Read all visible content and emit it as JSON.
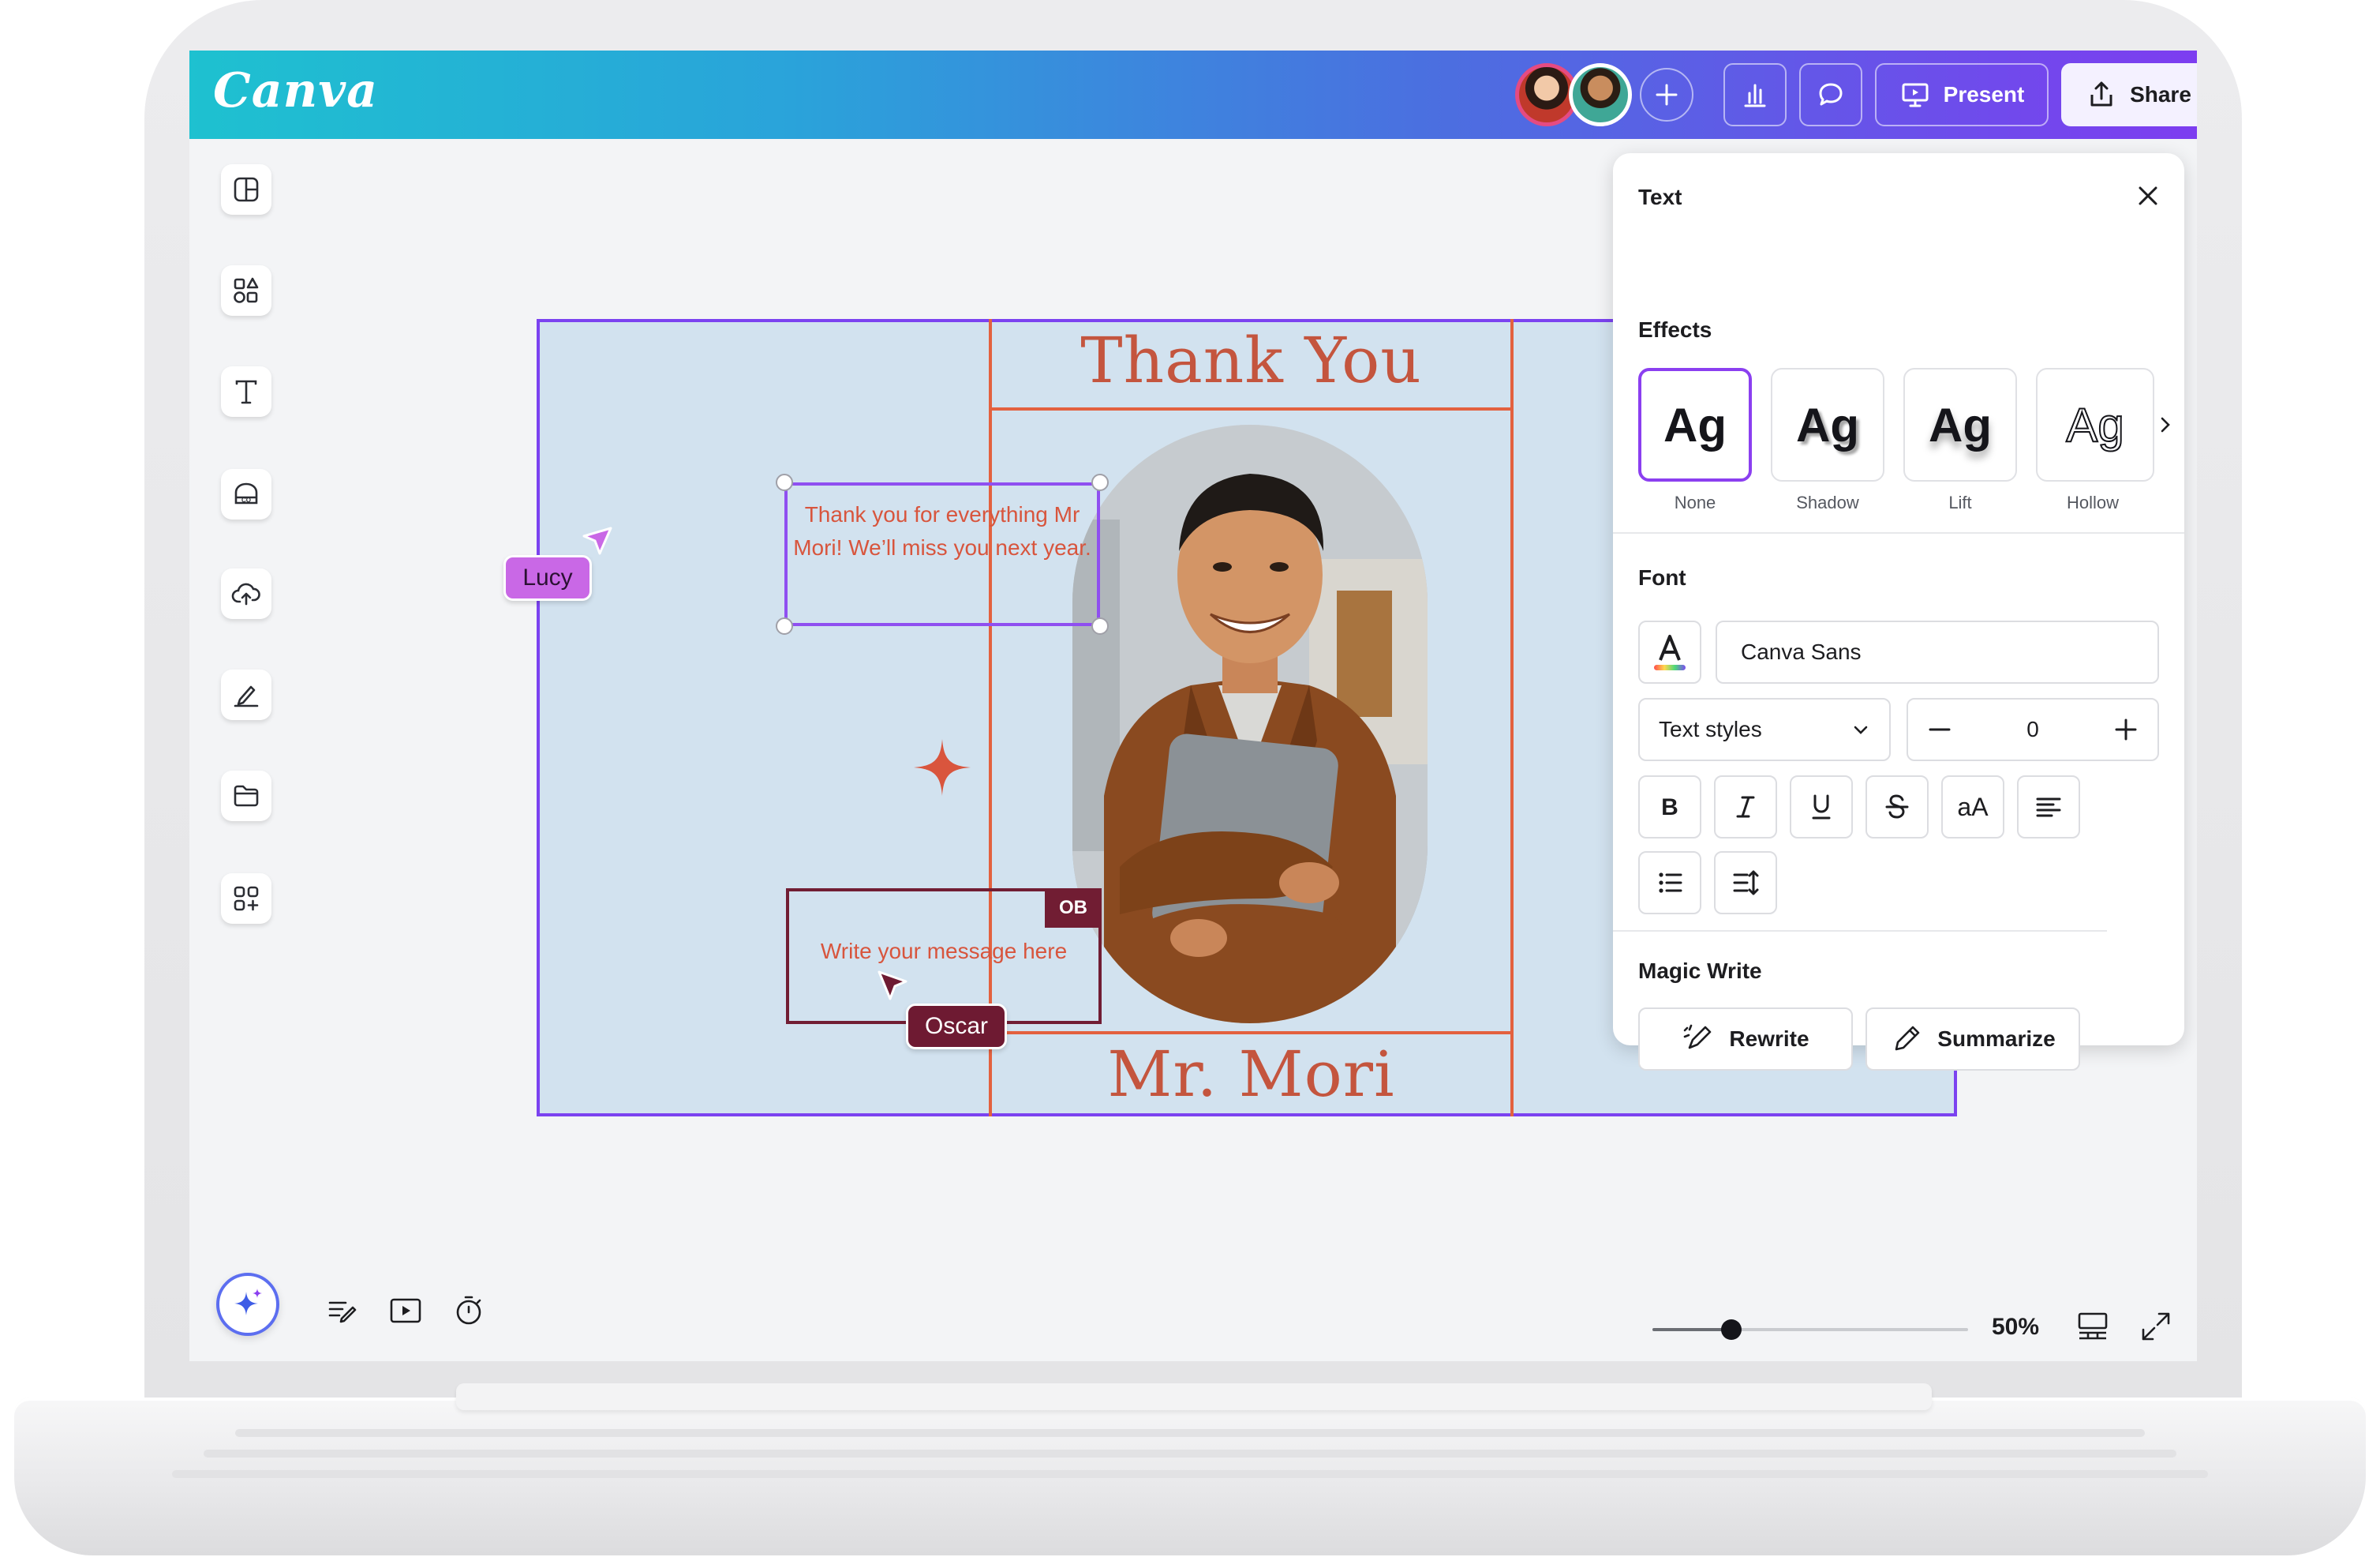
{
  "app": {
    "logo_text": "Canva"
  },
  "header": {
    "present_label": "Present",
    "share_label": "Share",
    "accent_gradient": [
      "#1ec1d0",
      "#4b6fe0",
      "#7d3df0"
    ]
  },
  "design": {
    "title": "Thank You",
    "name": "Mr. Mori",
    "note_1": "Thank you for everything Mr Mori! We’ll miss you next year.",
    "note_2": "Write your message here",
    "collaborator_badge": "OB",
    "cursor_lucy": "Lucy",
    "cursor_oscar": "Oscar",
    "accent_color": "#e3613f",
    "background_color": "#d2e2ef"
  },
  "text_panel": {
    "title": "Text",
    "effects_title": "Effects",
    "effect_sample": "Ag",
    "effects": [
      {
        "label": "None",
        "selected": true
      },
      {
        "label": "Shadow",
        "selected": false
      },
      {
        "label": "Lift",
        "selected": false
      },
      {
        "label": "Hollow",
        "selected": false
      }
    ],
    "font_title": "Font",
    "font_name": "Canva Sans",
    "text_styles_label": "Text styles",
    "font_size_value": "0",
    "case_label": "aA",
    "magic_write_title": "Magic Write",
    "rewrite_label": "Rewrite",
    "summarize_label": "Summarize"
  },
  "bottom_bar": {
    "zoom_label": "50%",
    "zoom_fraction": 0.25
  }
}
